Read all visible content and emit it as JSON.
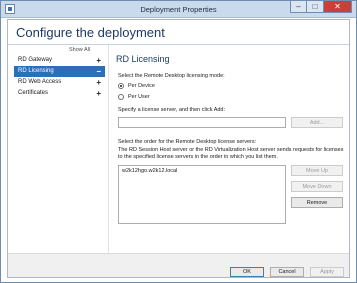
{
  "window": {
    "title": "Deployment Properties",
    "minimize_glyph": "–",
    "maximize_glyph": "□",
    "close_glyph": "✕"
  },
  "header": {
    "title": "Configure the deployment"
  },
  "nav": {
    "show_all": "Show All",
    "items": [
      {
        "label": "RD Gateway",
        "toggle": "+"
      },
      {
        "label": "RD Licensing",
        "toggle": "−"
      },
      {
        "label": "RD Web Access",
        "toggle": "+"
      },
      {
        "label": "Certificates",
        "toggle": "+"
      }
    ],
    "selected_index": 1
  },
  "licensing": {
    "title": "RD Licensing",
    "mode_prompt": "Select the Remote Desktop licensing mode:",
    "modes": [
      {
        "label": "Per Device",
        "selected": true
      },
      {
        "label": "Per User",
        "selected": false
      }
    ],
    "server_prompt": "Specify a license server, and then click Add:",
    "server_input_value": "",
    "add_button": "Add...",
    "order_prompt": "Select the order for the Remote Desktop license servers:",
    "order_desc_line1": "The RD Session Host server or the RD Virtualization Host server sends requests for licenses",
    "order_desc_line2": "to the specified license servers in the order in which you list them.",
    "servers": [
      "w2k12hgo.w2k12.local"
    ],
    "move_up_button": "Move Up",
    "move_down_button": "Move Down",
    "remove_button": "Remove"
  },
  "footer": {
    "ok_button": "OK",
    "cancel_button": "Cancel",
    "apply_button": "Apply"
  },
  "colors": {
    "title_bar": "#c9daec",
    "close_button": "#c7403a",
    "selected_nav": "#2d6fb6",
    "heading": "#1e3a64"
  }
}
